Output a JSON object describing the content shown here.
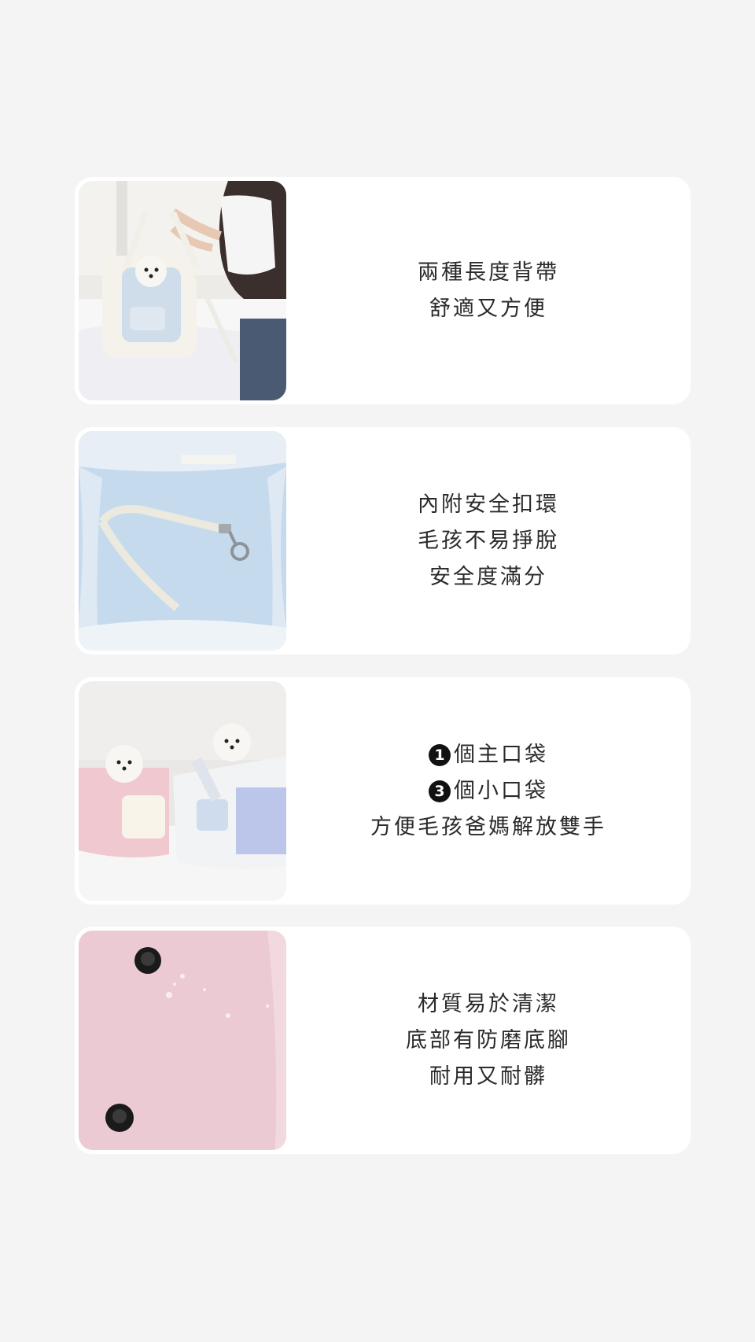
{
  "cards": [
    {
      "photo_alt": "carrier-bag-held-photo",
      "lines": [
        "兩種長度背帶",
        "舒適又方便"
      ]
    },
    {
      "photo_alt": "bag-interior-safety-clip-photo",
      "lines": [
        "內附安全扣環",
        "毛孩不易掙脫",
        "安全度滿分"
      ]
    },
    {
      "photo_alt": "two-dogs-in-bags-photo",
      "badge_lines": [
        {
          "badge": "1",
          "text": "個主口袋"
        },
        {
          "badge": "3",
          "text": "個小口袋"
        }
      ],
      "lines": [
        "方便毛孩爸媽解放雙手"
      ]
    },
    {
      "photo_alt": "pink-fabric-bottom-feet-photo",
      "lines": [
        "材質易於清潔",
        "底部有防磨底腳",
        "耐用又耐髒"
      ]
    }
  ]
}
